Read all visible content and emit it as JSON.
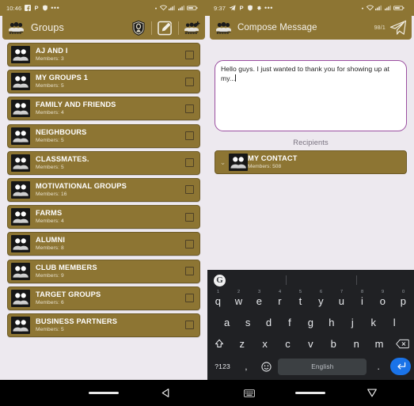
{
  "left_phone": {
    "status_bar": {
      "time": "10:46",
      "left_icons": [
        "facebook-icon",
        "pinterest-icon",
        "shield-app-icon",
        "more-dots-icon"
      ],
      "right_icons": [
        "dot-icon",
        "wifi-icon",
        "signal-icon",
        "signal-alt-icon",
        "battery-icon"
      ]
    },
    "app_bar": {
      "icon": "groups-icon",
      "title": "Groups",
      "actions": [
        {
          "name": "shield-icon"
        },
        {
          "name": "compose-icon"
        },
        {
          "name": "add-group-icon"
        }
      ]
    },
    "groups": [
      {
        "name": "AJ AND I",
        "members": "Members: 3",
        "checked": false
      },
      {
        "name": "MY GROUPS 1",
        "members": "Members: 5",
        "checked": false
      },
      {
        "name": "FAMILY AND FRIENDS",
        "members": "Members: 4",
        "checked": false
      },
      {
        "name": "NEIGHBOURS",
        "members": "Members: 5",
        "checked": false
      },
      {
        "name": "CLASSMATES.",
        "members": "Members: 5",
        "checked": false
      },
      {
        "name": "MOTIVATIONAL GROUPS",
        "members": "Members: 16",
        "checked": false
      },
      {
        "name": "FARMS",
        "members": "Members: 4",
        "checked": false
      },
      {
        "name": "ALUMNI",
        "members": "Members: 8",
        "checked": false
      },
      {
        "name": "CLUB MEMBERS",
        "members": "Members: 9",
        "checked": false
      },
      {
        "name": "TARGET GROUPS",
        "members": "Members: 6",
        "checked": false
      },
      {
        "name": "BUSINESS PARTNERS",
        "members": "Members: 5",
        "checked": false
      }
    ],
    "nav_bar": [
      {
        "name": "home-pill-icon"
      },
      {
        "name": "back-icon"
      }
    ]
  },
  "right_phone": {
    "status_bar": {
      "time": "9:37",
      "left_icons": [
        "telegram-icon",
        "pinterest-icon",
        "shield-app-icon",
        "app-icon",
        "more-dots-icon"
      ],
      "right_icons": [
        "dot-icon",
        "wifi-icon",
        "signal-icon",
        "signal-alt-icon",
        "battery-icon"
      ]
    },
    "app_bar": {
      "icon": "groups-icon",
      "title": "Compose Message",
      "counter": "98/1",
      "send_icon": "send-icon"
    },
    "message": {
      "text": "Hello guys. I just wanted to thank you for showing up at my..."
    },
    "recipients": {
      "label": "Recipients",
      "items": [
        {
          "name": "MY CONTACT",
          "members": "Members: 508",
          "expand_icon": "chevron-down-icon"
        }
      ]
    },
    "keyboard": {
      "suggestion_logo": "G",
      "row1": [
        {
          "key": "q",
          "hint": "1"
        },
        {
          "key": "w",
          "hint": "2"
        },
        {
          "key": "e",
          "hint": "3"
        },
        {
          "key": "r",
          "hint": "4"
        },
        {
          "key": "t",
          "hint": "5"
        },
        {
          "key": "y",
          "hint": "6"
        },
        {
          "key": "u",
          "hint": "7"
        },
        {
          "key": "i",
          "hint": "8"
        },
        {
          "key": "o",
          "hint": "9"
        },
        {
          "key": "p",
          "hint": "0"
        }
      ],
      "row2": [
        "a",
        "s",
        "d",
        "f",
        "g",
        "h",
        "j",
        "k",
        "l"
      ],
      "row3": [
        "z",
        "x",
        "c",
        "v",
        "b",
        "n",
        "m"
      ],
      "shift_key": "shift-icon",
      "backspace_key": "backspace-icon",
      "symbols_key": "?123",
      "comma_key": ",",
      "emoji_key": "emoji-icon",
      "space_key": "English",
      "period_key": ".",
      "enter_key": "enter-icon"
    },
    "nav_bar": [
      {
        "name": "keyboard-icon"
      },
      {
        "name": "home-pill-icon"
      },
      {
        "name": "hide-keyboard-icon"
      }
    ]
  },
  "colors": {
    "brand_gold": "#8d7533",
    "page_bg": "#ede9ef",
    "accent_purple": "#9b4fa0",
    "keyboard_bg": "#202124",
    "enter_blue": "#1a73e8"
  }
}
